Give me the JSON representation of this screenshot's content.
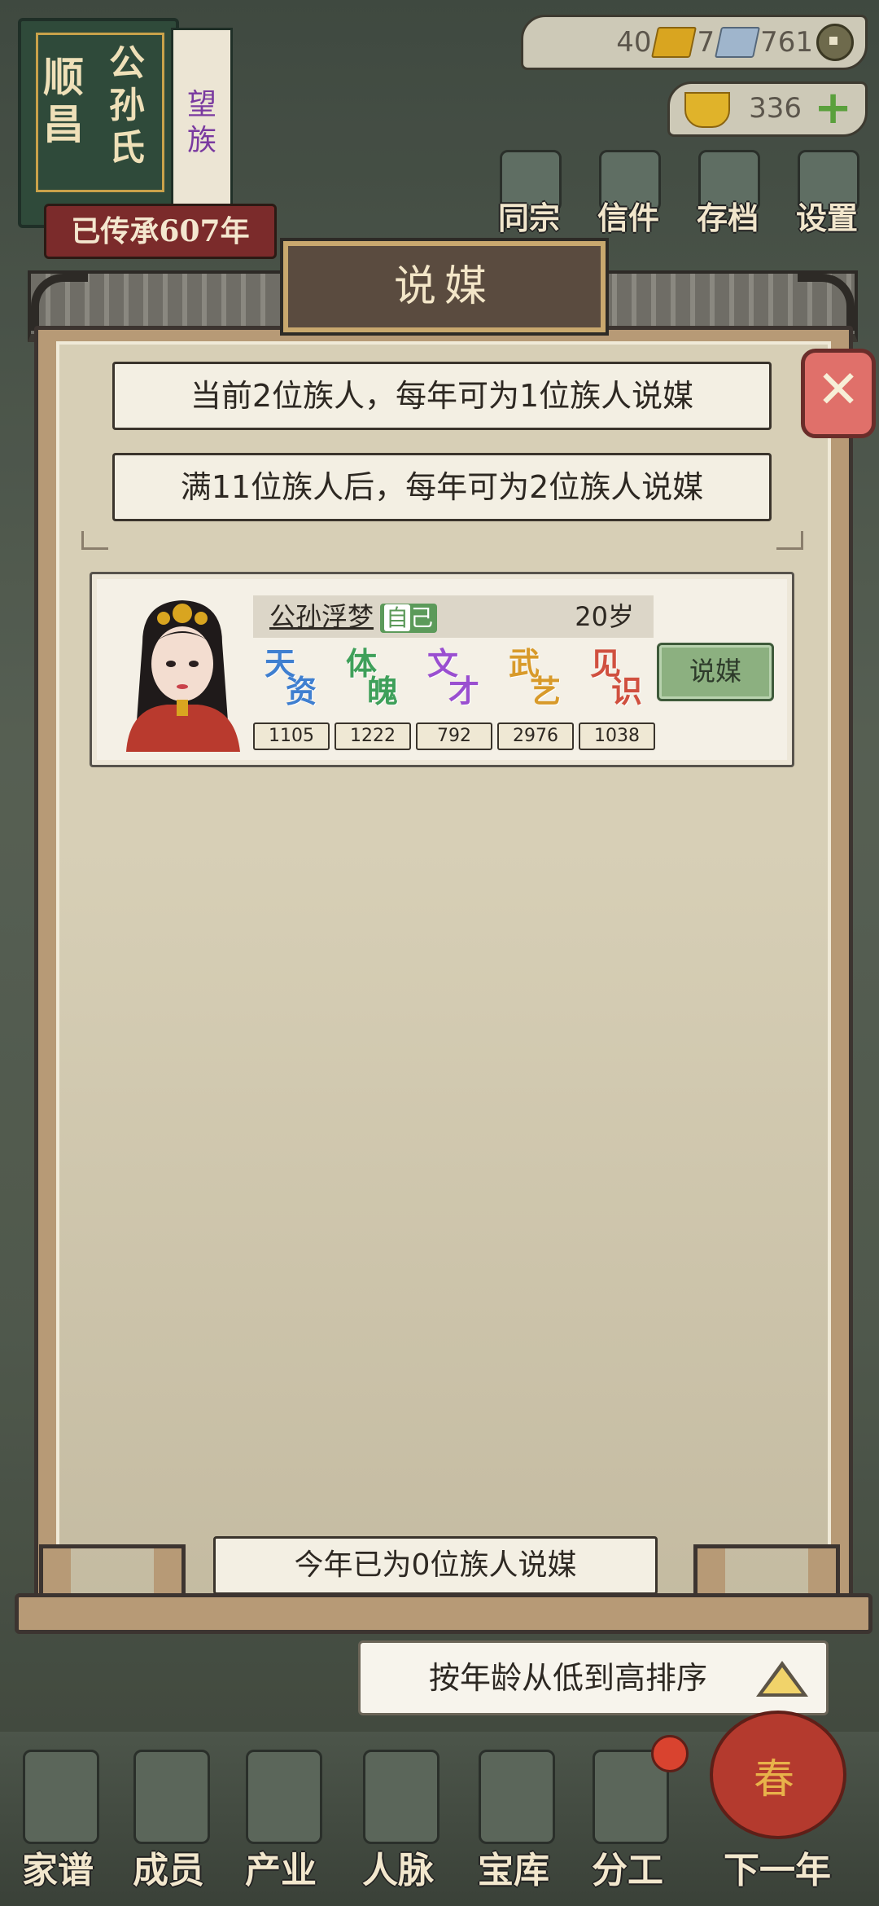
{
  "family": {
    "name_col1": "顺昌",
    "name_col2": "公孙氏",
    "tag": "望族",
    "inherit": "已传承607年"
  },
  "currency": {
    "gold_bars": "40",
    "silver_bars": "7",
    "coins": "761",
    "ingots": "336"
  },
  "top_menu": [
    {
      "label": "同宗",
      "icon": "clan-icon"
    },
    {
      "label": "信件",
      "icon": "letter-icon"
    },
    {
      "label": "存档",
      "icon": "save-icon"
    },
    {
      "label": "设置",
      "icon": "gear-icon"
    }
  ],
  "modal": {
    "title": "说媒",
    "info_line1": "当前2位族人，每年可为1位族人说媒",
    "info_line2": "满11位族人后，每年可为2位族人说媒",
    "year_status": "今年已为0位族人说媒",
    "sort_label": "按年龄从低到高排序"
  },
  "members": [
    {
      "name": "公孙浮梦",
      "badge_first": "自",
      "badge_rest": "己",
      "age": "20岁",
      "match_label": "说媒",
      "stats": [
        {
          "c1": "天",
          "c2": "资",
          "value": "1105",
          "color": "#3f7fd0"
        },
        {
          "c1": "体",
          "c2": "魄",
          "value": "1222",
          "color": "#3fa05a"
        },
        {
          "c1": "文",
          "c2": "才",
          "value": "792",
          "color": "#9a4fd0"
        },
        {
          "c1": "武",
          "c2": "艺",
          "value": "2976",
          "color": "#d89a2a"
        },
        {
          "c1": "见",
          "c2": "识",
          "value": "1038",
          "color": "#d0503f"
        }
      ]
    }
  ],
  "bottom_nav": [
    {
      "label": "家谱",
      "icon": "genealogy-icon"
    },
    {
      "label": "成员",
      "icon": "member-icon"
    },
    {
      "label": "产业",
      "icon": "estate-icon"
    },
    {
      "label": "人脉",
      "icon": "network-icon"
    },
    {
      "label": "宝库",
      "icon": "treasury-icon"
    },
    {
      "label": "分工",
      "icon": "division-icon"
    },
    {
      "label": "下一年",
      "icon": "lantern-icon"
    }
  ],
  "lantern_text": "春"
}
